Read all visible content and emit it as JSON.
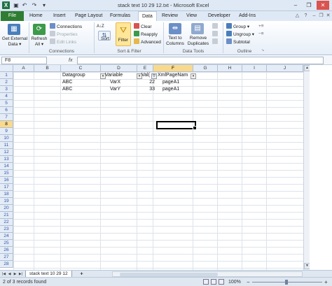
{
  "window": {
    "title": "stack text 10 29 12.txt - Microsoft Excel",
    "app_icon": "X",
    "minimize": "–",
    "restore": "❐",
    "close": "✕"
  },
  "qat": {
    "save_icon": "save-icon",
    "undo_icon": "undo-icon",
    "redo_icon": "redo-icon"
  },
  "tabs": {
    "file": "File",
    "items": [
      "Home",
      "Insert",
      "Page Layout",
      "Formulas",
      "Data",
      "Review",
      "View",
      "Developer",
      "Add-Ins"
    ],
    "active": "Data"
  },
  "ribbon": {
    "get_external_data": "Get External Data",
    "get_external_data_l1": "Get External",
    "get_external_data_l2": "Data ▾",
    "refresh_l1": "Refresh",
    "refresh_l2": "All ▾",
    "connections": "Connections",
    "properties": "Properties",
    "edit_links": "Edit Links",
    "group_connections": "Connections",
    "sort_az": "A↓Z",
    "sort": "Sort",
    "filter": "Filter",
    "clear": "Clear",
    "reapply": "Reapply",
    "advanced": "Advanced",
    "group_sort_filter": "Sort & Filter",
    "text_to_columns_l1": "Text to",
    "text_to_columns_l2": "Columns",
    "remove_duplicates_l1": "Remove",
    "remove_duplicates_l2": "Duplicates",
    "group_data_tools": "Data Tools",
    "group": "Group ▾",
    "ungroup": "Ungroup ▾",
    "subtotal": "Subtotal",
    "group_outline": "Outline"
  },
  "formula_bar": {
    "name_box": "F8",
    "fx": "fx",
    "value": ""
  },
  "columns": [
    "A",
    "B",
    "C",
    "D",
    "E",
    "F",
    "G",
    "H",
    "I",
    "J"
  ],
  "rows": [
    "1",
    "2",
    "3",
    "4",
    "5",
    "6",
    "7",
    "8",
    "9",
    "10",
    "11",
    "12",
    "13",
    "14",
    "15",
    "16",
    "17",
    "18",
    "19",
    "20",
    "21",
    "22",
    "23",
    "24",
    "25",
    "26",
    "27",
    "28"
  ],
  "selected": {
    "column": "F",
    "row": "8"
  },
  "table": {
    "headers": {
      "datagroup": "Datagroup",
      "variable": "Variable",
      "value": "Val(",
      "xmlpagename": "XmlPageNam"
    },
    "rows": [
      {
        "datagroup": "ABC",
        "variable": "VarX",
        "value": "22",
        "xmlpagename": "pageA1"
      },
      {
        "datagroup": "ABC",
        "variable": "VarY",
        "value": "33",
        "xmlpagename": "pageA1"
      }
    ]
  },
  "sheet": {
    "tab": "stack text 10 29 12"
  },
  "status": {
    "text": "2 of 3 records found",
    "zoom": "100%",
    "zoom_out": "−",
    "zoom_in": "+"
  },
  "colors": {
    "file_tab": "#2e7d32",
    "selection_header": "#f9d98b",
    "filter_active": "#ffe699"
  }
}
